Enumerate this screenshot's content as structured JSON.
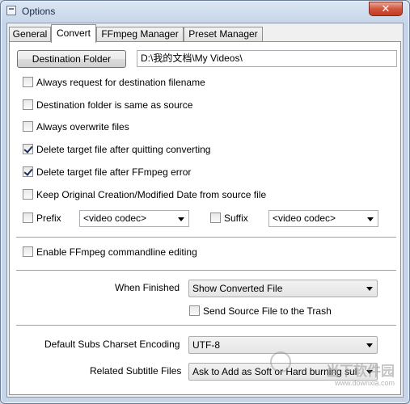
{
  "window": {
    "title": "Options",
    "close_glyph": "✕"
  },
  "tabs": [
    "General",
    "Convert",
    "FFmpeg Manager",
    "Preset Manager"
  ],
  "destination": {
    "button_label": "Destination Folder",
    "path": "D:\\我的文档\\My Videos\\"
  },
  "options": [
    {
      "label": "Always request for destination filename",
      "checked": false
    },
    {
      "label": "Destination folder is same as source",
      "checked": false
    },
    {
      "label": "Always overwrite files",
      "checked": false
    },
    {
      "label": "Delete target file after quitting converting",
      "checked": true
    },
    {
      "label": "Delete target file after FFmpeg error",
      "checked": true
    },
    {
      "label": "Keep Original Creation/Modified Date from source file",
      "checked": false
    }
  ],
  "prefix": {
    "label": "Prefix",
    "checked": false,
    "value": "<video codec>"
  },
  "suffix": {
    "label": "Suffix",
    "checked": false,
    "value": "<video codec>"
  },
  "commandline": {
    "label": "Enable FFmpeg commandline editing",
    "checked": false
  },
  "when_finished": {
    "label": "When Finished",
    "value": "Show Converted File",
    "send_trash_label": "Send Source File to the Trash",
    "send_trash_checked": false
  },
  "subs": {
    "charset_label": "Default Subs Charset Encoding",
    "charset_value": "UTF-8",
    "related_label": "Related Subtitle Files",
    "related_value": "Ask to Add as Soft or Hard burning sul"
  },
  "watermark": {
    "text": "当下软件园",
    "url": "www.downxia.com"
  }
}
